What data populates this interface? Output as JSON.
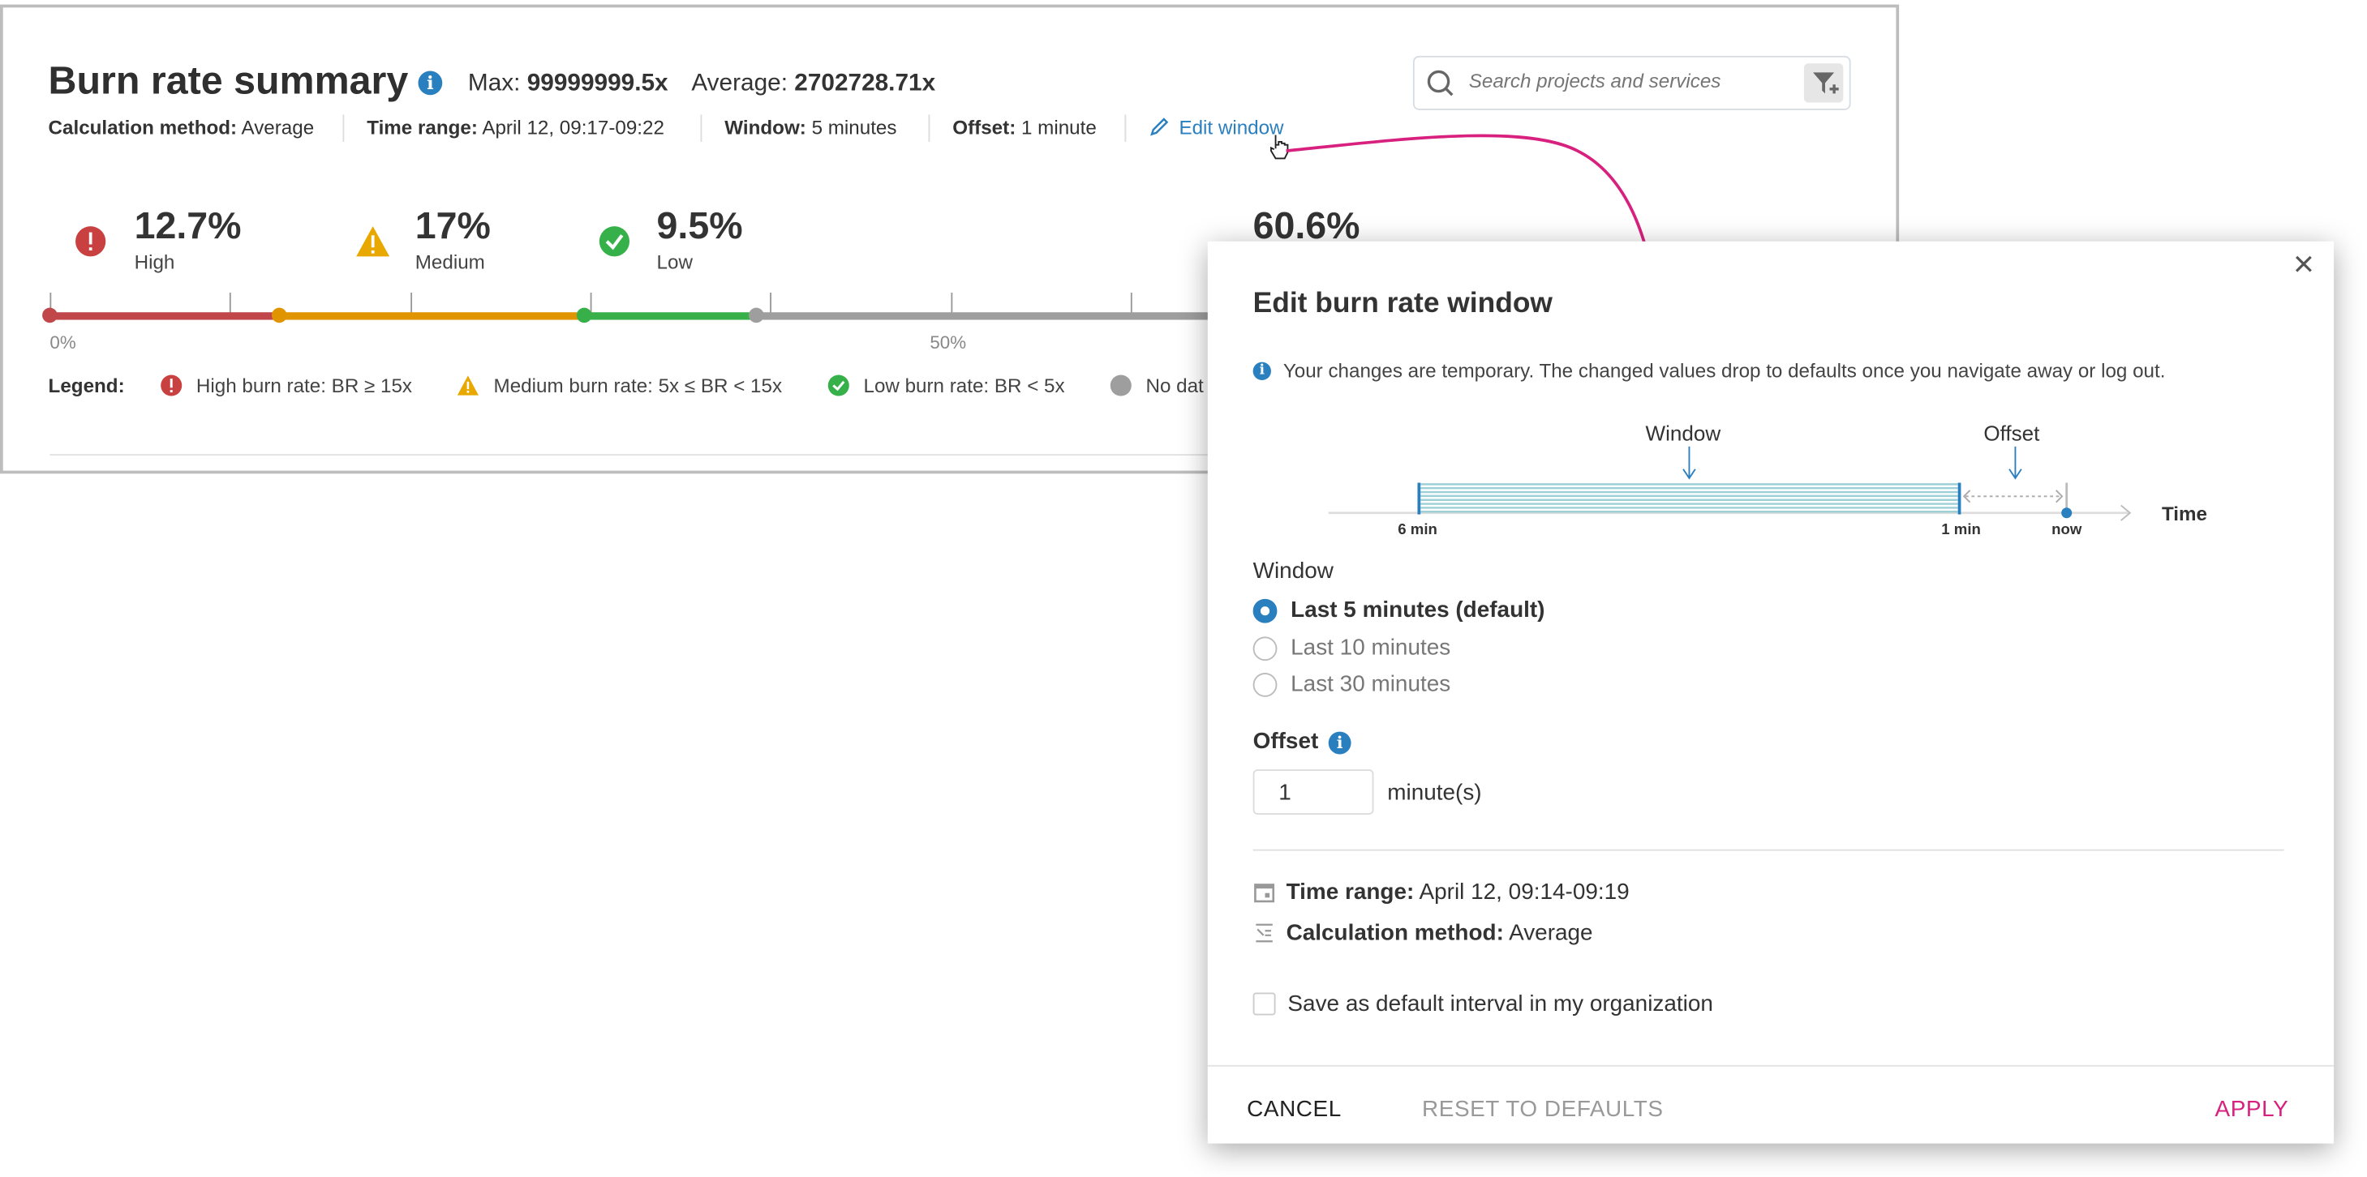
{
  "summary": {
    "title": "Burn rate summary",
    "max_label": "Max:",
    "max_value": "99999999.5x",
    "avg_label": "Average:",
    "avg_value": "2702728.71x",
    "meta": {
      "calc_label": "Calculation method:",
      "calc_value": "Average",
      "range_label": "Time range:",
      "range_value": "April 12, 09:17-09:22",
      "window_label": "Window:",
      "window_value": "5 minutes",
      "offset_label": "Offset:",
      "offset_value": "1 minute",
      "edit_link": "Edit window"
    },
    "search_placeholder": "Search projects and services",
    "stats": [
      {
        "value": "12.7%",
        "label": "High",
        "icon": "error-icon",
        "color": "#c94040"
      },
      {
        "value": "17%",
        "label": "Medium",
        "icon": "warning-icon",
        "color": "#e8a800"
      },
      {
        "value": "9.5%",
        "label": "Low",
        "icon": "check-badge-icon",
        "color": "#36b14a"
      },
      {
        "value": "60.6%",
        "label": "",
        "icon": "",
        "color": "#9e9e9e"
      }
    ],
    "distribution": {
      "high": 12.7,
      "medium": 17,
      "low": 9.5,
      "no_data": 60.6
    },
    "bar_colors": {
      "high": "#c0464a",
      "medium": "#e09400",
      "low": "#37b04a",
      "no_data": "#9e9e9e"
    },
    "axis_labels": [
      "0%",
      "50%"
    ],
    "legend": {
      "title": "Legend:",
      "items": [
        "High burn rate: BR ≥ 15x",
        "Medium burn rate: 5x ≤ BR < 15x",
        "Low burn rate: BR < 5x",
        "No dat"
      ]
    }
  },
  "dialog": {
    "title": "Edit burn rate window",
    "notice": "Your changes are temporary. The changed values drop to defaults once you navigate away or log out.",
    "diagram": {
      "window": "Window",
      "offset": "Offset",
      "time": "Time",
      "t6": "6 min",
      "t1": "1 min",
      "now": "now"
    },
    "window_heading": "Window",
    "window_options": [
      {
        "label": "Last 5 minutes (default)",
        "selected": true
      },
      {
        "label": "Last 10 minutes",
        "selected": false
      },
      {
        "label": "Last 30 minutes",
        "selected": false
      }
    ],
    "offset_heading": "Offset",
    "offset_value": "1",
    "offset_unit": "minute(s)",
    "range_label": "Time range:",
    "range_value": "April 12, 09:14-09:19",
    "calc_label": "Calculation method:",
    "calc_value": "Average",
    "save_default": "Save as default interval in my organization",
    "save_default_checked": false,
    "cancel": "CANCEL",
    "reset": "RESET TO DEFAULTS",
    "apply": "APPLY",
    "accent": "#d8207f"
  }
}
